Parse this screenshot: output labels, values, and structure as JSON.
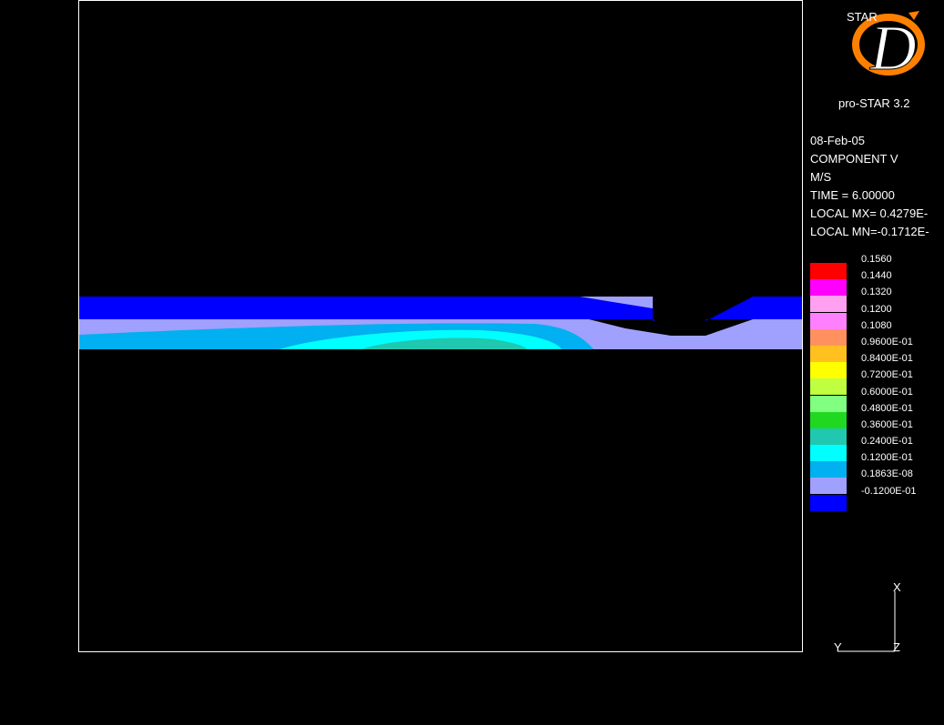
{
  "logo": {
    "text": "STAR",
    "letter": "D",
    "version": "pro-STAR 3.2"
  },
  "info": {
    "date": "08-Feb-05",
    "component": "COMPONENT V",
    "units": "M/S",
    "time": "TIME =  6.00000",
    "local_max": "LOCAL MX= 0.4279E-",
    "local_min": "LOCAL MN=-0.1712E-"
  },
  "legend": [
    {
      "label": "0.1560",
      "color": "#ff0000"
    },
    {
      "label": "0.1440",
      "color": "#ff00ff"
    },
    {
      "label": "0.1320",
      "color": "#ffa0f0"
    },
    {
      "label": "0.1200",
      "color": "#ff80ff"
    },
    {
      "label": "0.1080",
      "color": "#ff9060"
    },
    {
      "label": "0.9600E-01",
      "color": "#ffc020"
    },
    {
      "label": "0.8400E-01",
      "color": "#ffff00"
    },
    {
      "label": "0.7200E-01",
      "color": "#c0ff40"
    },
    {
      "label": "0.6000E-01",
      "color": "#80ff80"
    },
    {
      "label": "0.4800E-01",
      "color": "#20d820"
    },
    {
      "label": "0.3600E-01",
      "color": "#20c8b0"
    },
    {
      "label": "0.2400E-01",
      "color": "#00ffff"
    },
    {
      "label": "0.1200E-01",
      "color": "#00b0f0"
    },
    {
      "label": "0.1863E-08",
      "color": "#a0a0ff"
    },
    {
      "label": "-0.1200E-01",
      "color": "#0000ff"
    }
  ],
  "axes": {
    "x_label": "X",
    "y_label": "Y",
    "z_label": "Z"
  },
  "colors": {
    "background": "#000000",
    "frame": "#ffffff",
    "logo_orange": "#ff8000"
  }
}
